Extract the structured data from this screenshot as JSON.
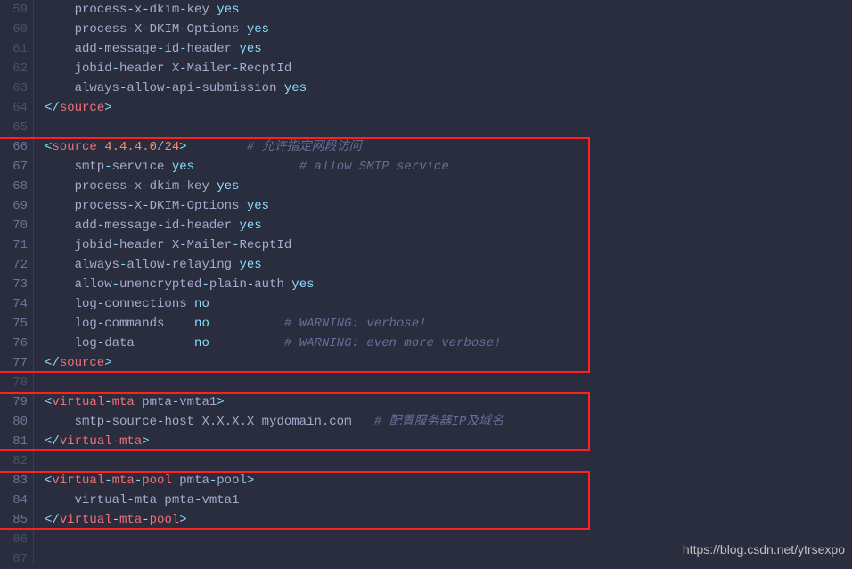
{
  "startLine": 59,
  "lineCount": 29,
  "watermark": "https://blog.csdn.net/ytrsexpo",
  "highlights": [
    {
      "fromLine": 66,
      "toLine": 77
    },
    {
      "fromLine": 79,
      "toLine": 81
    },
    {
      "fromLine": 83,
      "toLine": 85
    }
  ],
  "lines": [
    {
      "n": 59,
      "segs": [
        [
          "text",
          "    process"
        ],
        [
          "op",
          "-"
        ],
        [
          "text",
          "x"
        ],
        [
          "op",
          "-"
        ],
        [
          "text",
          "dkim"
        ],
        [
          "op",
          "-"
        ],
        [
          "text",
          "key "
        ],
        [
          "kw-yes",
          "yes"
        ]
      ]
    },
    {
      "n": 60,
      "segs": [
        [
          "text",
          "    process"
        ],
        [
          "op",
          "-"
        ],
        [
          "text",
          "X"
        ],
        [
          "op",
          "-"
        ],
        [
          "text",
          "DKIM"
        ],
        [
          "op",
          "-"
        ],
        [
          "text",
          "Options "
        ],
        [
          "kw-yes",
          "yes"
        ]
      ]
    },
    {
      "n": 61,
      "segs": [
        [
          "text",
          "    add"
        ],
        [
          "op",
          "-"
        ],
        [
          "text",
          "message"
        ],
        [
          "op",
          "-"
        ],
        [
          "text",
          "id"
        ],
        [
          "op",
          "-"
        ],
        [
          "text",
          "header "
        ],
        [
          "kw-yes",
          "yes"
        ]
      ]
    },
    {
      "n": 62,
      "segs": [
        [
          "text",
          "    jobid"
        ],
        [
          "op",
          "-"
        ],
        [
          "text",
          "header X"
        ],
        [
          "op",
          "-"
        ],
        [
          "text",
          "Mailer"
        ],
        [
          "op",
          "-"
        ],
        [
          "text",
          "RecptId"
        ]
      ]
    },
    {
      "n": 63,
      "segs": [
        [
          "text",
          "    always"
        ],
        [
          "op",
          "-"
        ],
        [
          "text",
          "allow"
        ],
        [
          "op",
          "-"
        ],
        [
          "text",
          "api"
        ],
        [
          "op",
          "-"
        ],
        [
          "text",
          "submission "
        ],
        [
          "kw-yes",
          "yes"
        ]
      ]
    },
    {
      "n": 64,
      "segs": [
        [
          "angle",
          "</"
        ],
        [
          "tag",
          "source"
        ],
        [
          "angle",
          ">"
        ]
      ]
    },
    {
      "n": 65,
      "segs": []
    },
    {
      "n": 66,
      "segs": [
        [
          "angle",
          "<"
        ],
        [
          "tag",
          "source "
        ],
        [
          "valnum",
          "4.4.4.0"
        ],
        [
          "text",
          "/"
        ],
        [
          "valnum",
          "24"
        ],
        [
          "angle",
          ">"
        ],
        [
          "text",
          "        "
        ],
        [
          "cmt",
          "# 允许指定网段访问"
        ]
      ]
    },
    {
      "n": 67,
      "segs": [
        [
          "text",
          "    smtp"
        ],
        [
          "op",
          "-"
        ],
        [
          "text",
          "service "
        ],
        [
          "kw-yes",
          "yes"
        ],
        [
          "text",
          "              "
        ],
        [
          "cmt",
          "# allow SMTP service"
        ]
      ]
    },
    {
      "n": 68,
      "segs": [
        [
          "text",
          "    process"
        ],
        [
          "op",
          "-"
        ],
        [
          "text",
          "x"
        ],
        [
          "op",
          "-"
        ],
        [
          "text",
          "dkim"
        ],
        [
          "op",
          "-"
        ],
        [
          "text",
          "key "
        ],
        [
          "kw-yes",
          "yes"
        ]
      ]
    },
    {
      "n": 69,
      "segs": [
        [
          "text",
          "    process"
        ],
        [
          "op",
          "-"
        ],
        [
          "text",
          "X"
        ],
        [
          "op",
          "-"
        ],
        [
          "text",
          "DKIM"
        ],
        [
          "op",
          "-"
        ],
        [
          "text",
          "Options "
        ],
        [
          "kw-yes",
          "yes"
        ]
      ]
    },
    {
      "n": 70,
      "segs": [
        [
          "text",
          "    add"
        ],
        [
          "op",
          "-"
        ],
        [
          "text",
          "message"
        ],
        [
          "op",
          "-"
        ],
        [
          "text",
          "id"
        ],
        [
          "op",
          "-"
        ],
        [
          "text",
          "header "
        ],
        [
          "kw-yes",
          "yes"
        ]
      ]
    },
    {
      "n": 71,
      "segs": [
        [
          "text",
          "    jobid"
        ],
        [
          "op",
          "-"
        ],
        [
          "text",
          "header X"
        ],
        [
          "op",
          "-"
        ],
        [
          "text",
          "Mailer"
        ],
        [
          "op",
          "-"
        ],
        [
          "text",
          "RecptId"
        ]
      ]
    },
    {
      "n": 72,
      "segs": [
        [
          "text",
          "    always"
        ],
        [
          "op",
          "-"
        ],
        [
          "text",
          "allow"
        ],
        [
          "op",
          "-"
        ],
        [
          "text",
          "relaying "
        ],
        [
          "kw-yes",
          "yes"
        ]
      ]
    },
    {
      "n": 73,
      "segs": [
        [
          "text",
          "    allow"
        ],
        [
          "op",
          "-"
        ],
        [
          "text",
          "unencrypted"
        ],
        [
          "op",
          "-"
        ],
        [
          "text",
          "plain"
        ],
        [
          "op",
          "-"
        ],
        [
          "text",
          "auth "
        ],
        [
          "kw-yes",
          "yes"
        ]
      ]
    },
    {
      "n": 74,
      "segs": [
        [
          "text",
          "    log"
        ],
        [
          "op",
          "-"
        ],
        [
          "text",
          "connections "
        ],
        [
          "kw-no",
          "no"
        ]
      ]
    },
    {
      "n": 75,
      "segs": [
        [
          "text",
          "    log"
        ],
        [
          "op",
          "-"
        ],
        [
          "text",
          "commands    "
        ],
        [
          "kw-no",
          "no"
        ],
        [
          "text",
          "          "
        ],
        [
          "cmt",
          "# WARNING: verbose!"
        ]
      ]
    },
    {
      "n": 76,
      "segs": [
        [
          "text",
          "    log"
        ],
        [
          "op",
          "-"
        ],
        [
          "text",
          "data        "
        ],
        [
          "kw-no",
          "no"
        ],
        [
          "text",
          "          "
        ],
        [
          "cmt",
          "# WARNING: even more verbose!"
        ]
      ]
    },
    {
      "n": 77,
      "segs": [
        [
          "angle",
          "</"
        ],
        [
          "tag",
          "source"
        ],
        [
          "angle",
          ">"
        ]
      ]
    },
    {
      "n": 78,
      "segs": []
    },
    {
      "n": 79,
      "segs": [
        [
          "angle",
          "<"
        ],
        [
          "tag",
          "virtual"
        ],
        [
          "op",
          "-"
        ],
        [
          "tag",
          "mta "
        ],
        [
          "attr",
          "pmta"
        ],
        [
          "op",
          "-"
        ],
        [
          "attr",
          "vmta1"
        ],
        [
          "angle",
          ">"
        ]
      ]
    },
    {
      "n": 80,
      "segs": [
        [
          "text",
          "    smtp"
        ],
        [
          "op",
          "-"
        ],
        [
          "text",
          "source"
        ],
        [
          "op",
          "-"
        ],
        [
          "text",
          "host X.X.X.X mydomain.com   "
        ],
        [
          "cmt",
          "# 配置服务器IP及域名"
        ]
      ]
    },
    {
      "n": 81,
      "segs": [
        [
          "angle",
          "</"
        ],
        [
          "tag",
          "virtual"
        ],
        [
          "op",
          "-"
        ],
        [
          "tag",
          "mta"
        ],
        [
          "angle",
          ">"
        ]
      ]
    },
    {
      "n": 82,
      "segs": []
    },
    {
      "n": 83,
      "segs": [
        [
          "angle",
          "<"
        ],
        [
          "tag",
          "virtual"
        ],
        [
          "op",
          "-"
        ],
        [
          "tag",
          "mta"
        ],
        [
          "op",
          "-"
        ],
        [
          "tag",
          "pool "
        ],
        [
          "attr",
          "pmta"
        ],
        [
          "op",
          "-"
        ],
        [
          "attr",
          "pool"
        ],
        [
          "angle",
          ">"
        ]
      ]
    },
    {
      "n": 84,
      "segs": [
        [
          "text",
          "    virtual"
        ],
        [
          "op",
          "-"
        ],
        [
          "text",
          "mta pmta"
        ],
        [
          "op",
          "-"
        ],
        [
          "text",
          "vmta1"
        ]
      ]
    },
    {
      "n": 85,
      "segs": [
        [
          "angle",
          "</"
        ],
        [
          "tag",
          "virtual"
        ],
        [
          "op",
          "-"
        ],
        [
          "tag",
          "mta"
        ],
        [
          "op",
          "-"
        ],
        [
          "tag",
          "pool"
        ],
        [
          "angle",
          ">"
        ]
      ]
    },
    {
      "n": 86,
      "segs": []
    },
    {
      "n": 87,
      "segs": []
    }
  ]
}
